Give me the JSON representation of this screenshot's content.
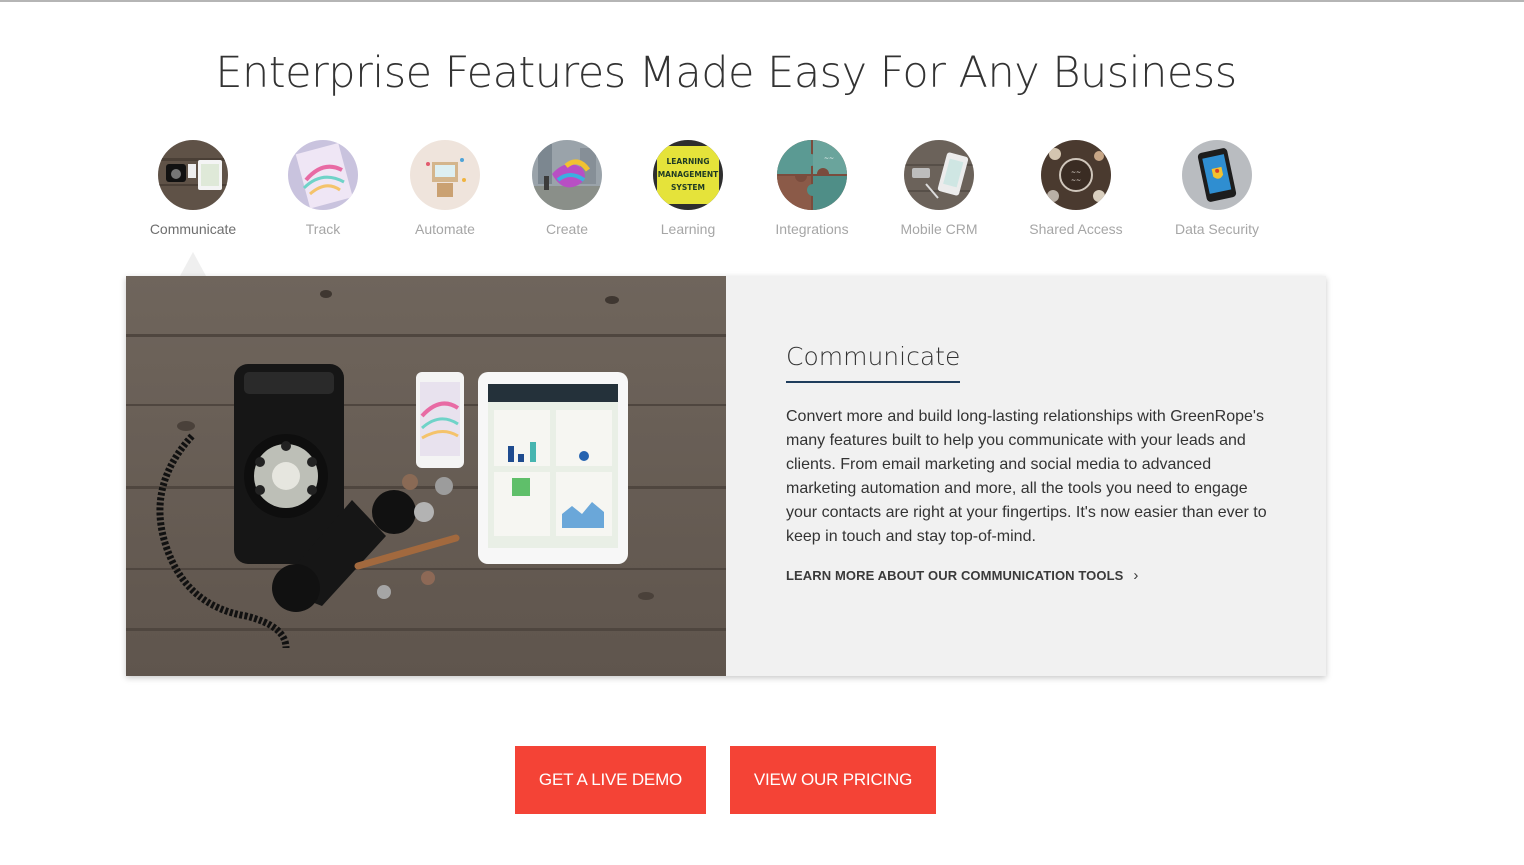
{
  "heading": "Enterprise Features Made Easy For Any Business",
  "tabs": [
    {
      "label": "Communicate",
      "active": true
    },
    {
      "label": "Track",
      "active": false
    },
    {
      "label": "Automate",
      "active": false
    },
    {
      "label": "Create",
      "active": false
    },
    {
      "label": "Learning",
      "active": false
    },
    {
      "label": "Integrations",
      "active": false
    },
    {
      "label": "Mobile CRM",
      "active": false
    },
    {
      "label": "Shared Access",
      "active": false
    },
    {
      "label": "Data Security",
      "active": false
    }
  ],
  "learning_sign_text": "LEARNING MANAGEMENT SYSTEM",
  "panel": {
    "title": "Communicate",
    "description": "Convert more and build long-lasting relationships with GreenRope's many features built to help you communicate with your leads and clients. From email marketing and social media to advanced marketing automation and more, all the tools you need to engage your contacts are right at your fingertips. It's now easier than ever to keep in touch and stay top-of-mind.",
    "link_label": "LEARN MORE ABOUT OUR COMMUNICATION TOOLS"
  },
  "buttons": {
    "demo": "GET A LIVE DEMO",
    "pricing": "VIEW OUR PRICING"
  },
  "colors": {
    "cta": "#f44336",
    "title_underline": "#1f3d5c",
    "panel_bg": "#f1f1f1"
  }
}
